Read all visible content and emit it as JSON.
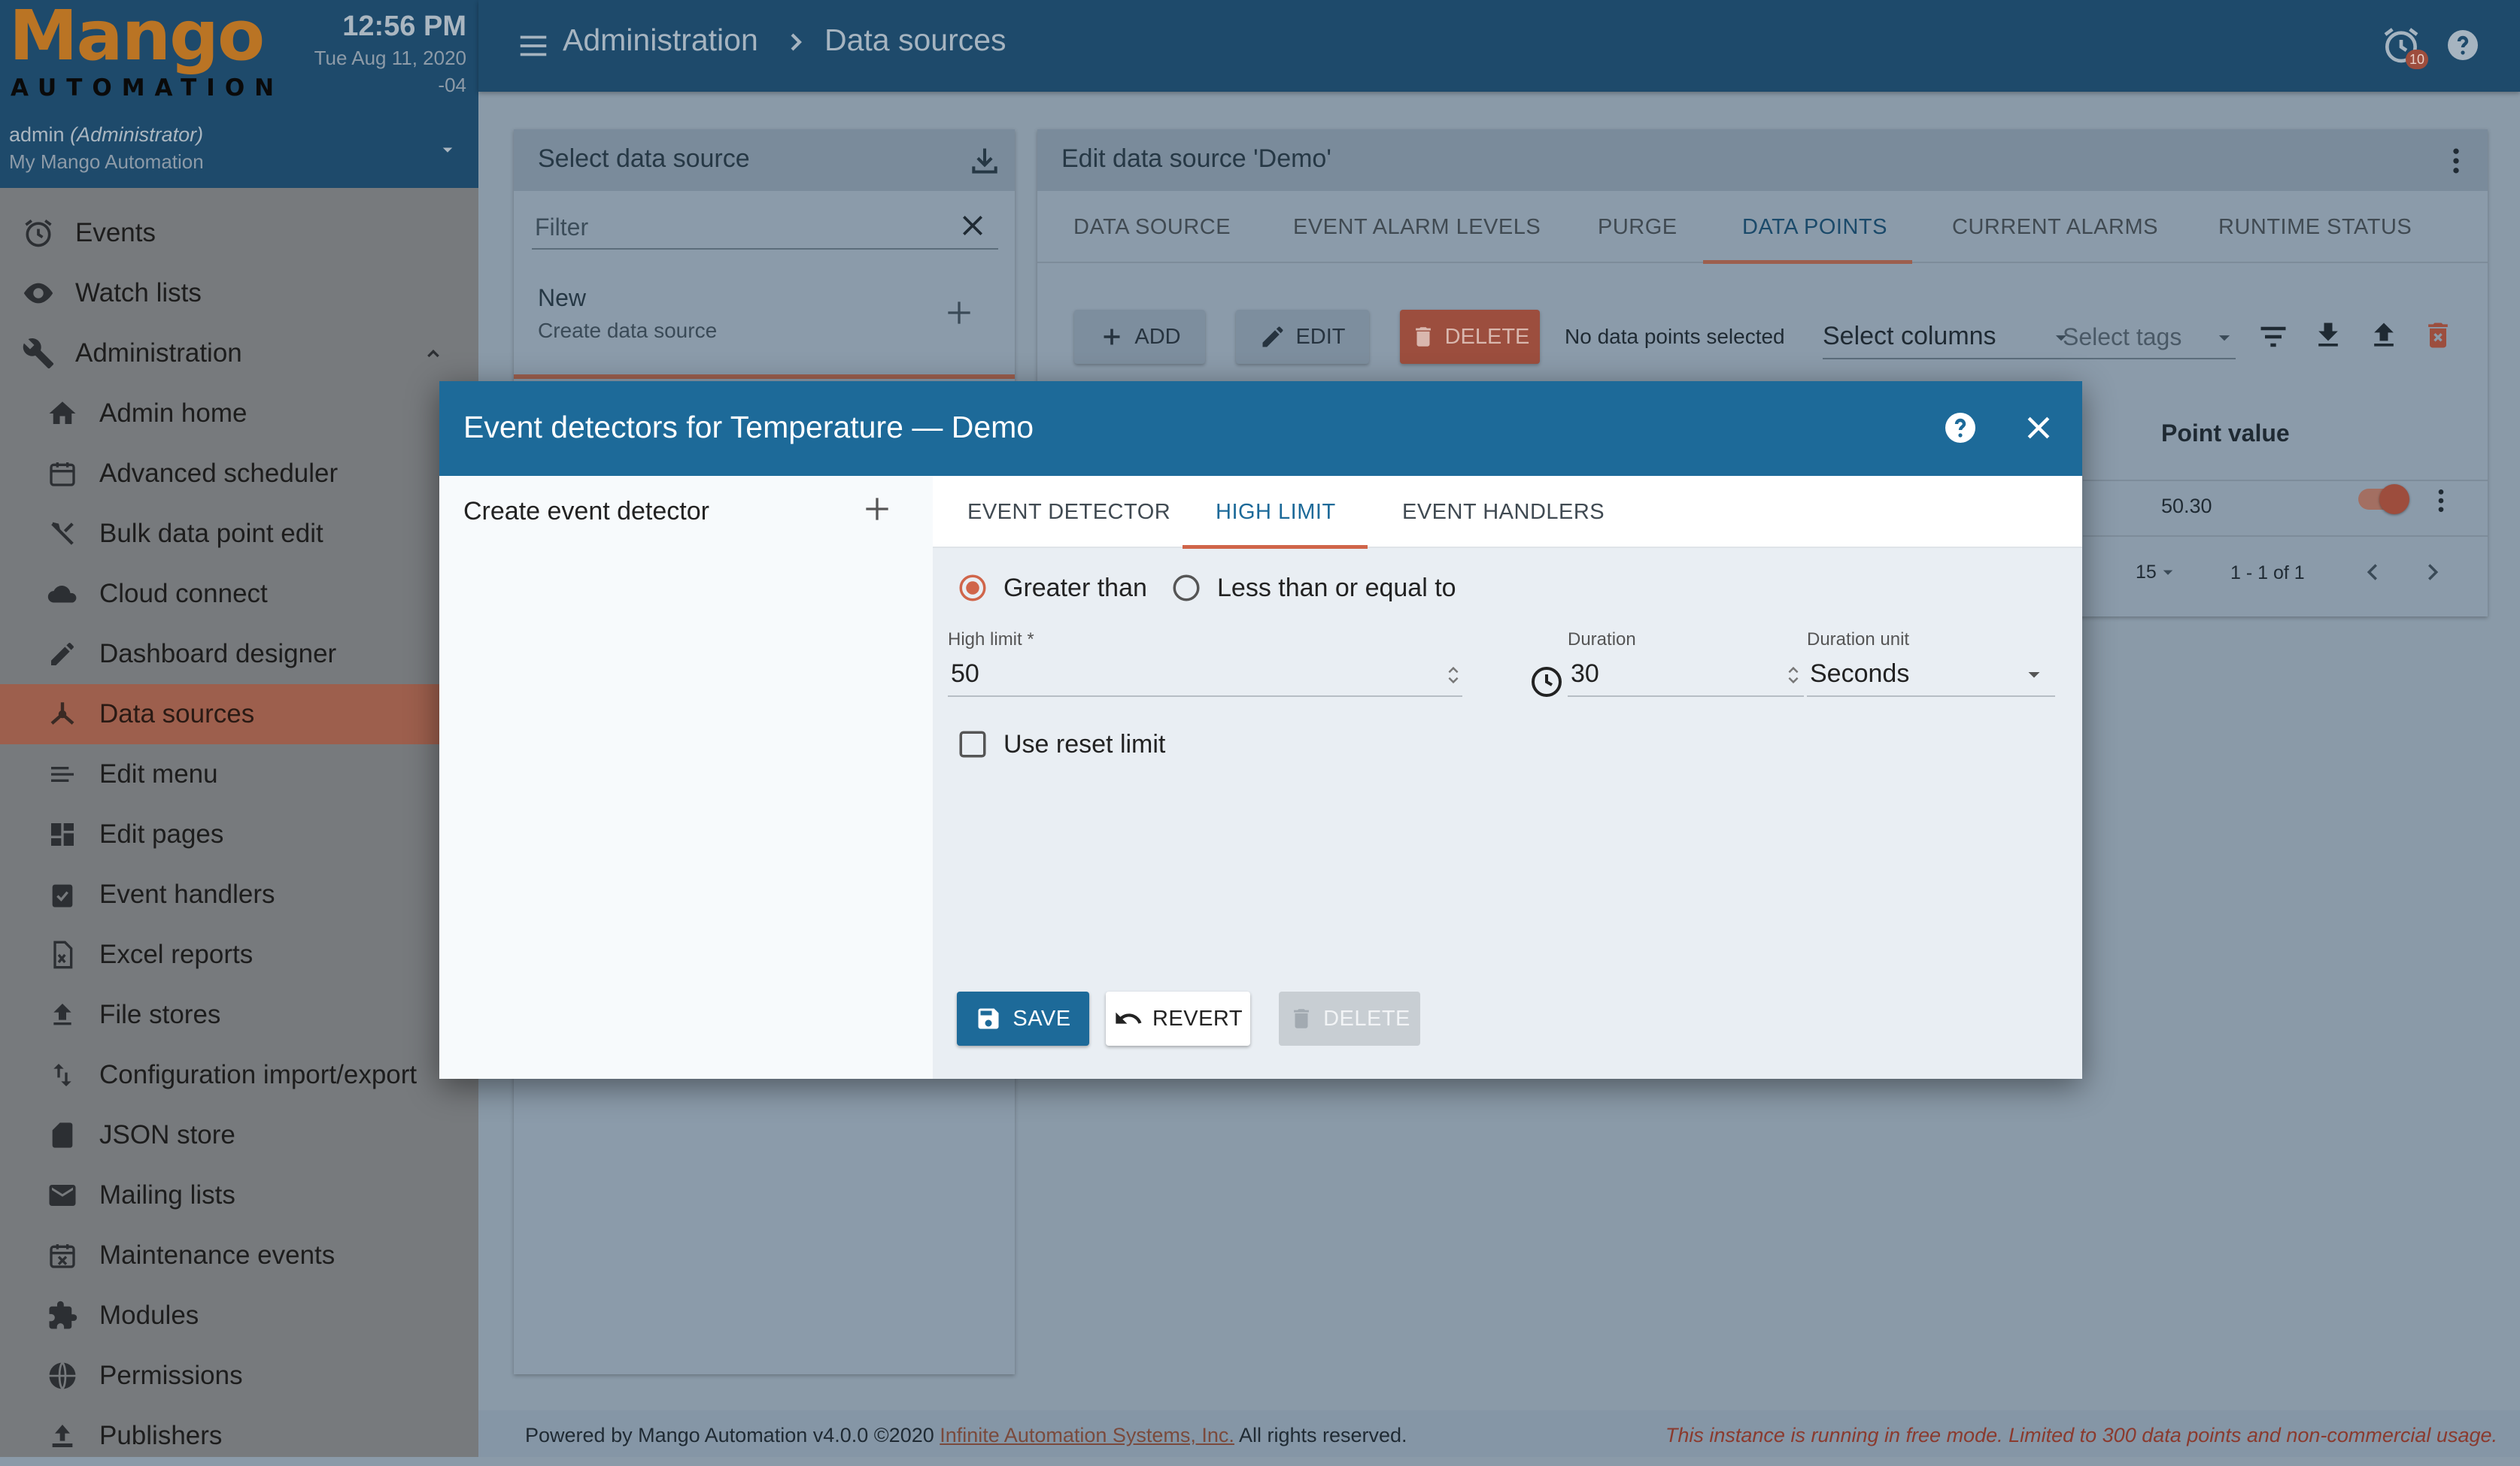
{
  "sidebar": {
    "logo_top": "Mango",
    "logo_bottom": "AUTOMATION",
    "time": "12:56 PM",
    "date": "Tue Aug 11, 2020",
    "tz": "-04",
    "user_name": "admin",
    "user_role": "(Administrator)",
    "user_sub": "My Mango Automation",
    "top_items": [
      {
        "label": "Events",
        "icon": "alarm-clock-icon"
      },
      {
        "label": "Watch lists",
        "icon": "eye-icon"
      },
      {
        "label": "Administration",
        "icon": "wrench-icon"
      }
    ],
    "sub_items": [
      {
        "label": "Admin home",
        "icon": "home-icon"
      },
      {
        "label": "Advanced scheduler",
        "icon": "calendar-icon"
      },
      {
        "label": "Bulk data point edit",
        "icon": "tools-icon"
      },
      {
        "label": "Cloud connect",
        "icon": "cloud-icon"
      },
      {
        "label": "Dashboard designer",
        "icon": "pencil-icon"
      },
      {
        "label": "Data sources",
        "icon": "hub-icon"
      },
      {
        "label": "Edit menu",
        "icon": "menu-lines-icon"
      },
      {
        "label": "Edit pages",
        "icon": "dashboard-icon"
      },
      {
        "label": "Event handlers",
        "icon": "clipboard-check-icon"
      },
      {
        "label": "Excel reports",
        "icon": "excel-file-icon"
      },
      {
        "label": "File stores",
        "icon": "upload-icon"
      },
      {
        "label": "Configuration import/export",
        "icon": "import-export-icon"
      },
      {
        "label": "JSON store",
        "icon": "sd-card-icon"
      },
      {
        "label": "Mailing lists",
        "icon": "mail-icon"
      },
      {
        "label": "Maintenance events",
        "icon": "calendar-remove-icon"
      },
      {
        "label": "Modules",
        "icon": "puzzle-icon"
      },
      {
        "label": "Permissions",
        "icon": "globe-lock-icon"
      },
      {
        "label": "Publishers",
        "icon": "publish-icon"
      }
    ]
  },
  "topbar": {
    "crumb_1": "Administration",
    "crumb_2": "Data sources",
    "alarm_count": "10"
  },
  "select_card": {
    "title": "Select data source",
    "filter_placeholder": "Filter",
    "new_title": "New",
    "new_sub": "Create data source"
  },
  "edit_card": {
    "title": "Edit data source 'Demo'",
    "tabs": [
      "DATA SOURCE",
      "EVENT ALARM LEVELS",
      "PURGE",
      "DATA POINTS",
      "CURRENT ALARMS",
      "RUNTIME STATUS"
    ],
    "add_label": "ADD",
    "edit_label": "EDIT",
    "delete_label": "DELETE",
    "no_points": "No data points selected",
    "select_columns": "Select columns",
    "select_tags": "Select tags",
    "col_point_value": "Point value",
    "row_value": "50.30",
    "page_size": "15",
    "page_range": "1 - 1 of 1"
  },
  "dialog": {
    "title": "Event detectors for Temperature — Demo",
    "create_label": "Create event detector",
    "tabs": [
      "EVENT DETECTOR",
      "HIGH LIMIT",
      "EVENT HANDLERS"
    ],
    "radio_greater": "Greater than",
    "radio_less": "Less than or equal to",
    "high_limit_label": "High limit *",
    "high_limit_value": "50",
    "duration_label": "Duration",
    "duration_value": "30",
    "duration_unit_label": "Duration unit",
    "duration_unit_value": "Seconds",
    "reset_label": "Use reset limit",
    "save_label": "SAVE",
    "revert_label": "REVERT",
    "delete_label": "DELETE"
  },
  "footer": {
    "left_prefix": "Powered by Mango Automation v4.0.0 ©2020 ",
    "left_link": "Infinite Automation Systems, Inc.",
    "left_suffix": " All rights reserved.",
    "right": "This instance is running in free mode. Limited to 300 data points and non-commercial usage."
  },
  "colors": {
    "header_blue": "#1e4a6b",
    "dialog_blue": "#1d6a99",
    "accent": "#d0654a",
    "logo_orange": "#ba7424"
  }
}
